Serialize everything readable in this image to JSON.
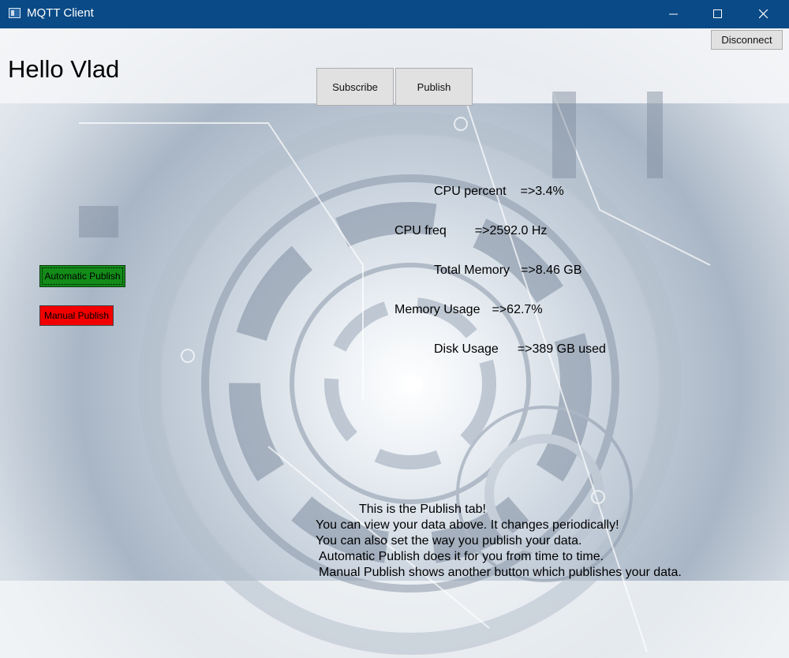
{
  "window": {
    "title": "MQTT Client",
    "icon": "app-window-icon"
  },
  "toolbar": {
    "disconnect_label": "Disconnect",
    "subscribe_label": "Subscribe",
    "publish_label": "Publish"
  },
  "greeting": "Hello Vlad",
  "modes": {
    "automatic_label": "Automatic Publish",
    "manual_label": "Manual Publish",
    "automatic_color": "#138c19",
    "manual_color": "#f20000"
  },
  "stats": {
    "cpu_percent": {
      "label": "CPU percent",
      "value": "=>3.4%"
    },
    "cpu_freq": {
      "label": "CPU freq",
      "value": "=>2592.0 Hz"
    },
    "total_memory": {
      "label": "Total Memory",
      "value": "=>8.46 GB"
    },
    "memory_usage": {
      "label": "Memory Usage",
      "value": "=>62.7%"
    },
    "disk_usage": {
      "label": "Disk Usage",
      "value": "=>389 GB used"
    }
  },
  "info": {
    "line1": "This is the Publish tab!",
    "line2": "You can view your data above. It changes periodically!",
    "line3": "You can also set the way you publish your data.",
    "line4": "Automatic Publish does it for you from time to time.",
    "line5": "Manual Publish shows another button which publishes your data."
  },
  "colors": {
    "titlebar": "#0a4a86"
  }
}
